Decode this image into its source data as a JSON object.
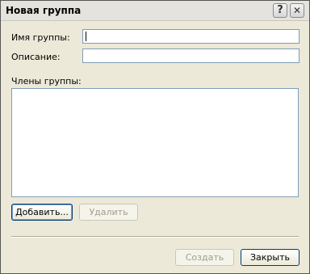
{
  "window": {
    "title": "Новая группа",
    "help_button": "?",
    "close_button": "✕"
  },
  "form": {
    "group_name_label": "Имя группы:",
    "group_name_value": "",
    "description_label": "Описание:",
    "description_value": "",
    "members_label": "Члены группы:",
    "members": []
  },
  "buttons": {
    "add": "Добавить...",
    "remove": "Удалить",
    "create": "Создать",
    "close": "Закрыть"
  }
}
